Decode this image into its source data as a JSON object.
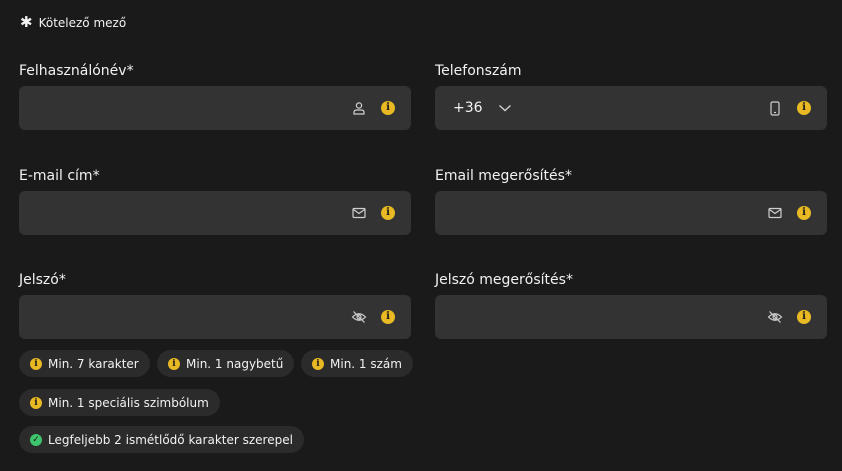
{
  "required_note": {
    "star": "✱",
    "text": "Kötelező mező"
  },
  "fields": {
    "username": {
      "label": "Felhasználónév*",
      "value": ""
    },
    "phone": {
      "label": "Telefonszám",
      "prefix": "+36",
      "value": ""
    },
    "email": {
      "label": "E-mail cím*",
      "value": ""
    },
    "email_confirm": {
      "label": "Email megerősítés*",
      "value": ""
    },
    "password": {
      "label": "Jelszó*",
      "value": ""
    },
    "password_confirm": {
      "label": "Jelszó megerősítés*",
      "value": ""
    }
  },
  "info_glyph": "i",
  "ok_glyph": "✓",
  "requirements": [
    {
      "text": "Min. 7 karakter",
      "status": "info"
    },
    {
      "text": "Min. 1 nagybetű",
      "status": "info"
    },
    {
      "text": "Min. 1 szám",
      "status": "info"
    },
    {
      "text": "Min. 1 speciális szimbólum",
      "status": "info"
    },
    {
      "text": "Legfeljebb 2 ismétlődő karakter szerepel",
      "status": "ok"
    }
  ],
  "colors": {
    "background": "#1a1a1a",
    "input": "#333333",
    "chip": "#2b2b2b",
    "info": "#e8b923",
    "ok": "#3ec46d"
  },
  "icons": {
    "username": "user-icon",
    "phone": "mobile-phone-icon",
    "email": "envelope-icon",
    "password": "eye-slash-icon",
    "prefix_dropdown": "chevron-down-icon"
  }
}
